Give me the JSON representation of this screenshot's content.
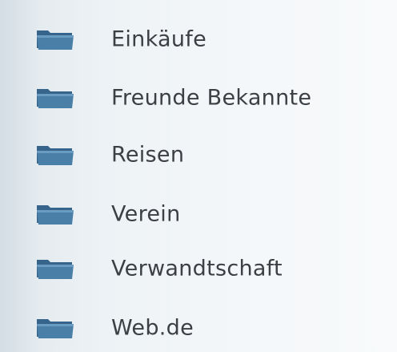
{
  "folders": {
    "items": [
      {
        "label": "Einkäufe",
        "icon": "folder-icon"
      },
      {
        "label": "Freunde Bekannte",
        "icon": "folder-icon"
      },
      {
        "label": "Reisen",
        "icon": "folder-icon"
      },
      {
        "label": "Verein",
        "icon": "folder-icon"
      },
      {
        "label": "Verwandtschaft",
        "icon": "folder-icon"
      },
      {
        "label": "Web.de",
        "icon": "folder-icon"
      }
    ]
  },
  "colors": {
    "folder_body": "#4a7fa8",
    "folder_tab": "#36648a",
    "folder_front": "#5a8db5",
    "text": "#3c3f44",
    "background": "#eef3f6"
  }
}
